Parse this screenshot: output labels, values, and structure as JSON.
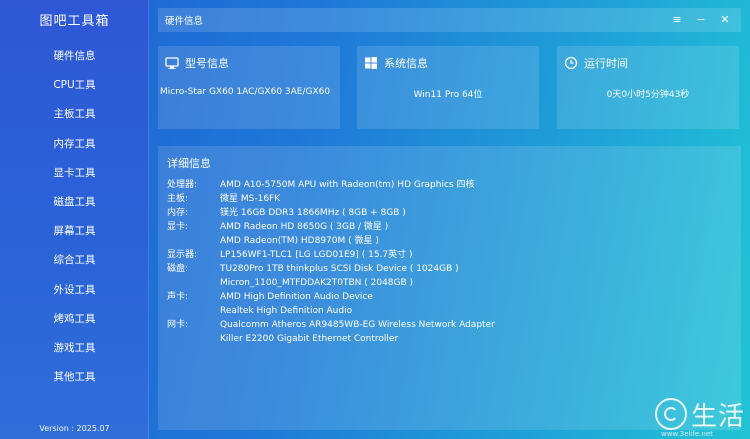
{
  "app": {
    "title": "图吧工具箱",
    "version": "Version : 2025.07"
  },
  "sidebar": {
    "items": [
      {
        "label": "硬件信息"
      },
      {
        "label": "CPU工具"
      },
      {
        "label": "主板工具"
      },
      {
        "label": "内存工具"
      },
      {
        "label": "显卡工具"
      },
      {
        "label": "磁盘工具"
      },
      {
        "label": "屏幕工具"
      },
      {
        "label": "综合工具"
      },
      {
        "label": "外设工具"
      },
      {
        "label": "烤鸡工具"
      },
      {
        "label": "游戏工具"
      },
      {
        "label": "其他工具"
      }
    ]
  },
  "topbar": {
    "title": "硬件信息",
    "menu": "≡",
    "minimize": "−",
    "close": "✕"
  },
  "cards": [
    {
      "title": "型号信息",
      "value": "Micro-Star  GX60 1AC/GX60 3AE/GX60",
      "icon": "monitor-icon"
    },
    {
      "title": "系统信息",
      "value": "Win11 Pro 64位",
      "icon": "windows-icon"
    },
    {
      "title": "运行时间",
      "value": "0天0小时5分钟43秒",
      "icon": "clock-icon"
    }
  ],
  "details": {
    "title": "详细信息",
    "rows": [
      {
        "label": "处理器:",
        "value": "AMD A10-5750M APU with Radeon(tm) HD Graphics 四核"
      },
      {
        "label": "主板:",
        "value": "微星 MS-16FK"
      },
      {
        "label": "内存:",
        "value": "镁光 16GB DDR3 1866MHz ( 8GB + 8GB )"
      },
      {
        "label": "显卡:",
        "value": "AMD Radeon HD 8650G ( 3GB / 微星 )"
      },
      {
        "label": "",
        "value": "AMD Radeon(TM) HD8970M ( 微星 )"
      },
      {
        "label": "显示器:",
        "value": "LP156WF1-TLC1 [LG LGD01E9] ( 15.7英寸 )"
      },
      {
        "label": "磁盘:",
        "value": "TU280Pro 1TB thinkplus SCSI Disk Device ( 1024GB )"
      },
      {
        "label": "",
        "value": "Micron_1100_MTFDDAK2T0TBN ( 2048GB )"
      },
      {
        "label": "声卡:",
        "value": "AMD High Definition Audio Device"
      },
      {
        "label": "",
        "value": "Realtek High Definition Audio"
      },
      {
        "label": "网卡:",
        "value": "Qualcomm Atheros AR9485WB-EG Wireless Network Adapter"
      },
      {
        "label": "",
        "value": "Killer E2200 Gigabit Ethernet Controller"
      }
    ]
  },
  "watermark": {
    "text": "生活",
    "url": "www.3elife.net"
  }
}
